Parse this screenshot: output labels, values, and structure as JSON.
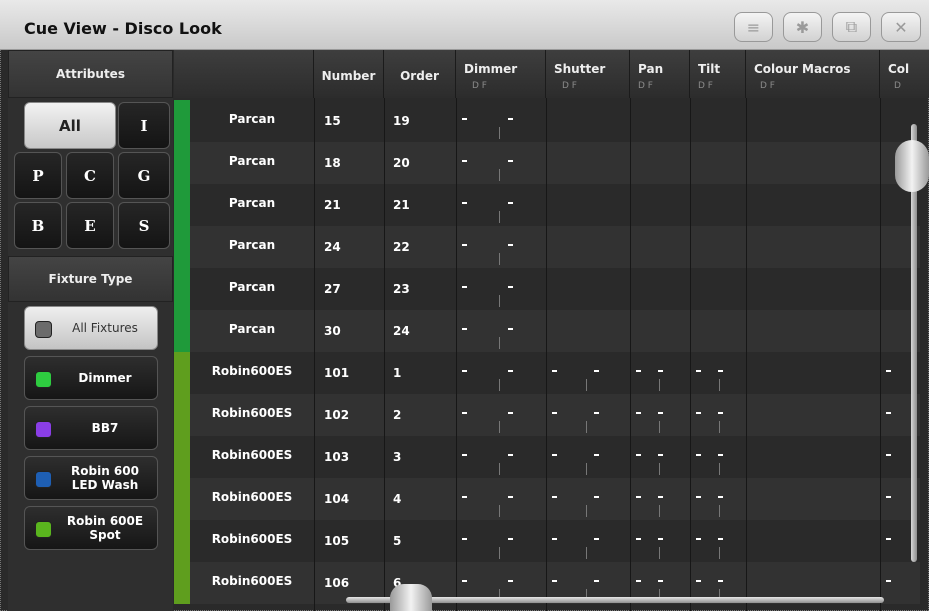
{
  "window": {
    "title": "Cue View - Disco Look",
    "buttons": [
      {
        "name": "menu-button",
        "icon": "menu-icon",
        "glyph": "≡"
      },
      {
        "name": "settings-button",
        "icon": "gear-icon",
        "glyph": "✱"
      },
      {
        "name": "detach-button",
        "icon": "detach-icon",
        "glyph": "⧉"
      },
      {
        "name": "close-button",
        "icon": "close-icon",
        "glyph": "✕"
      }
    ]
  },
  "sidebar": {
    "attributes_header": "Attributes",
    "attribute_buttons": [
      "All",
      "I",
      "P",
      "C",
      "G",
      "B",
      "E",
      "S"
    ],
    "fixture_type_header": "Fixture Type",
    "fixture_types": [
      {
        "label": "All Fixtures",
        "color": "#6b6b6b",
        "selected": true
      },
      {
        "label": "Dimmer",
        "color": "#2ecc40",
        "selected": false
      },
      {
        "label": "BB7",
        "color": "#8a3ee6",
        "selected": false
      },
      {
        "label": "Robin 600 LED Wash",
        "color": "#1e5fb4",
        "selected": false
      },
      {
        "label": "Robin 600E Spot",
        "color": "#5ab51e",
        "selected": false
      }
    ]
  },
  "table": {
    "columns": [
      {
        "label": "",
        "sub": ""
      },
      {
        "label": "Number",
        "sub": ""
      },
      {
        "label": "Order",
        "sub": ""
      },
      {
        "label": "Dimmer",
        "sub": "D   F"
      },
      {
        "label": "Shutter",
        "sub": "D   F"
      },
      {
        "label": "Pan",
        "sub": "D F"
      },
      {
        "label": "Tilt",
        "sub": "D F"
      },
      {
        "label": "Colour Macros",
        "sub": "D         F"
      },
      {
        "label": "Col",
        "sub": "D"
      }
    ],
    "rows": [
      {
        "name": "Parcan",
        "number": "15",
        "order": "19",
        "type": "parcan"
      },
      {
        "name": "Parcan",
        "number": "18",
        "order": "20",
        "type": "parcan"
      },
      {
        "name": "Parcan",
        "number": "21",
        "order": "21",
        "type": "parcan"
      },
      {
        "name": "Parcan",
        "number": "24",
        "order": "22",
        "type": "parcan"
      },
      {
        "name": "Parcan",
        "number": "27",
        "order": "23",
        "type": "parcan"
      },
      {
        "name": "Parcan",
        "number": "30",
        "order": "24",
        "type": "parcan"
      },
      {
        "name": "Robin600ES",
        "number": "101",
        "order": "1",
        "type": "robin"
      },
      {
        "name": "Robin600ES",
        "number": "102",
        "order": "2",
        "type": "robin"
      },
      {
        "name": "Robin600ES",
        "number": "103",
        "order": "3",
        "type": "robin"
      },
      {
        "name": "Robin600ES",
        "number": "104",
        "order": "4",
        "type": "robin"
      },
      {
        "name": "Robin600ES",
        "number": "105",
        "order": "5",
        "type": "robin"
      },
      {
        "name": "Robin600ES",
        "number": "106",
        "order": "6",
        "type": "robin"
      }
    ]
  },
  "colors": {
    "parcan_strip": "#1f9a3a",
    "robin_strip": "#5f9e1e",
    "row_dark": "#2a2a2a",
    "row_light": "#323232"
  }
}
